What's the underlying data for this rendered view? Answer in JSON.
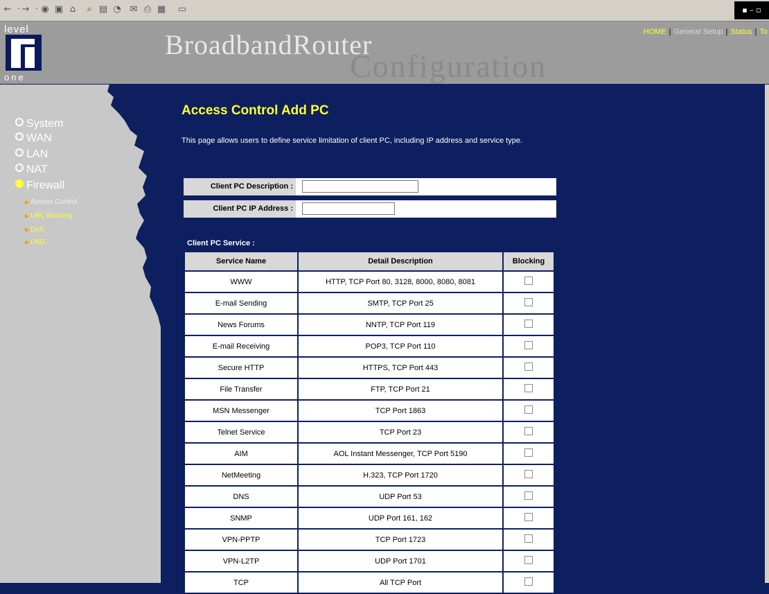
{
  "toolbar": {
    "icons": [
      "back-icon",
      "forward-icon",
      "stop-icon",
      "refresh-icon",
      "home-icon",
      "search-icon",
      "favorites-icon",
      "history-icon",
      "mail-icon",
      "print-icon",
      "edit-icon",
      "discuss-icon"
    ]
  },
  "header": {
    "logo_top": "level",
    "logo_bottom": "one",
    "brand_line1": "BroadbandRouter",
    "brand_line2": "Configuration",
    "links": [
      "HOME",
      "General Setup",
      "Status",
      "To"
    ]
  },
  "sidebar": {
    "items": [
      {
        "label": "System"
      },
      {
        "label": "WAN"
      },
      {
        "label": "LAN"
      },
      {
        "label": "NAT"
      },
      {
        "label": "Firewall"
      }
    ],
    "subitems": [
      {
        "label": "Access Control"
      },
      {
        "label": "URL Blocking"
      },
      {
        "label": "DoS"
      },
      {
        "label": "DMZ"
      }
    ]
  },
  "main": {
    "title": "Access Control Add PC",
    "description": "This page allows users to define service limitation of client PC, including IP address and service type.",
    "form": {
      "desc_label": "Client PC Description :",
      "desc_value": "",
      "ip_label": "Client PC IP Address :",
      "ip_value": ""
    },
    "service_section_label": "Client PC Service :",
    "table": {
      "headers": [
        "Service Name",
        "Detail Description",
        "Blocking"
      ],
      "rows": [
        {
          "name": "WWW",
          "desc": "HTTP, TCP Port 80, 3128, 8000, 8080, 8081",
          "blocked": false
        },
        {
          "name": "E-mail Sending",
          "desc": "SMTP, TCP Port 25",
          "blocked": false
        },
        {
          "name": "News Forums",
          "desc": "NNTP, TCP Port 119",
          "blocked": false
        },
        {
          "name": "E-mail Receiving",
          "desc": "POP3, TCP Port 110",
          "blocked": false
        },
        {
          "name": "Secure HTTP",
          "desc": "HTTPS, TCP Port 443",
          "blocked": false
        },
        {
          "name": "File Transfer",
          "desc": "FTP, TCP Port 21",
          "blocked": false
        },
        {
          "name": "MSN Messenger",
          "desc": "TCP Port 1863",
          "blocked": false
        },
        {
          "name": "Telnet Service",
          "desc": "TCP Port 23",
          "blocked": false
        },
        {
          "name": "AIM",
          "desc": "AOL Instant Messenger, TCP Port 5190",
          "blocked": false
        },
        {
          "name": "NetMeeting",
          "desc": "H.323, TCP Port 1720",
          "blocked": false
        },
        {
          "name": "DNS",
          "desc": "UDP Port 53",
          "blocked": false
        },
        {
          "name": "SNMP",
          "desc": "UDP Port 161, 162",
          "blocked": false
        },
        {
          "name": "VPN-PPTP",
          "desc": "TCP Port 1723",
          "blocked": false
        },
        {
          "name": "VPN-L2TP",
          "desc": "UDP Port 1701",
          "blocked": false
        },
        {
          "name": "TCP",
          "desc": "All TCP Port",
          "blocked": false
        }
      ]
    }
  },
  "colors": {
    "background": "#0d1f5e",
    "sidebar": "#c8c8c8",
    "accent": "#ffff33",
    "header": "#9c9c9c"
  }
}
